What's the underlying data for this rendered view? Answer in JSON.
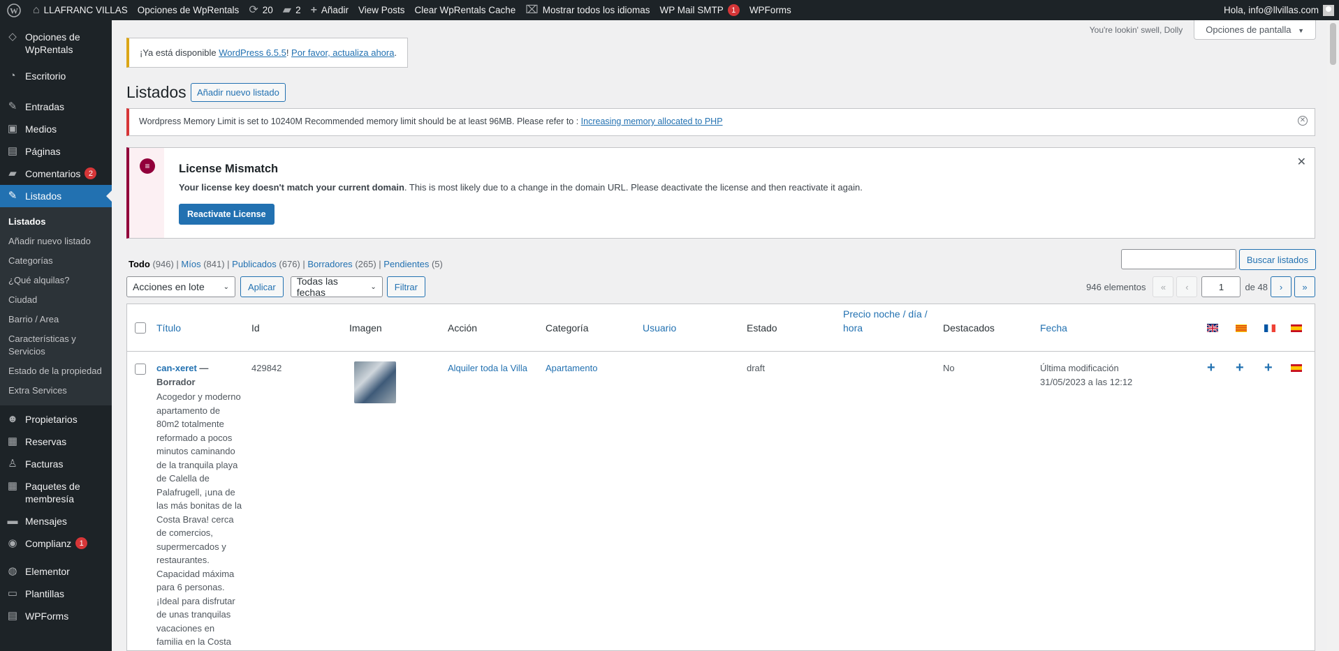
{
  "adminbar": {
    "site_name": "LLAFRANC VILLAS",
    "options": "Opciones de WpRentals",
    "updates_count": "20",
    "comments_count": "2",
    "add": "Añadir",
    "view_posts": "View Posts",
    "clear_cache": "Clear WpRentals Cache",
    "languages": "Mostrar todos los idiomas",
    "smtp": "WP Mail SMTP",
    "smtp_badge": "1",
    "wpforms": "WPForms",
    "greeting": "Hola, info@llvillas.com"
  },
  "sidebar": {
    "items": [
      {
        "label": "Opciones de WpRentals",
        "icon": "diamond-icon"
      },
      {
        "label": "Escritorio",
        "icon": "dashboard-icon"
      },
      {
        "label": "Entradas",
        "icon": "pin-icon"
      },
      {
        "label": "Medios",
        "icon": "media-icon"
      },
      {
        "label": "Páginas",
        "icon": "pages-icon"
      },
      {
        "label": "Comentarios",
        "icon": "comments-icon",
        "badge": "2"
      },
      {
        "label": "Listados",
        "icon": "pin-icon"
      }
    ],
    "submenu": [
      "Listados",
      "Añadir nuevo listado",
      "Categorías",
      "¿Qué alquilas?",
      "Ciudad",
      "Barrio / Area",
      "Características y Servicios",
      "Estado de la propiedad",
      "Extra Services"
    ],
    "items2": [
      {
        "label": "Propietarios",
        "icon": "users-icon"
      },
      {
        "label": "Reservas",
        "icon": "calendar-icon"
      },
      {
        "label": "Facturas",
        "icon": "invoice-icon"
      },
      {
        "label": "Paquetes de membresía",
        "icon": "package-icon"
      },
      {
        "label": "Mensajes",
        "icon": "messages-icon"
      },
      {
        "label": "Complianz",
        "icon": "complianz-icon",
        "badge": "1"
      },
      {
        "label": "Elementor",
        "icon": "elementor-icon"
      },
      {
        "label": "Plantillas",
        "icon": "folder-icon"
      },
      {
        "label": "WPForms",
        "icon": "wpforms-icon"
      }
    ]
  },
  "header": {
    "dolly": "You're lookin' swell, Dolly",
    "screen_options": "Opciones de pantalla"
  },
  "update_notice": {
    "prefix": "¡Ya está disponible ",
    "link1": "WordPress 6.5.5",
    "middle": "! ",
    "link2": "Por favor, actualiza ahora",
    "suffix": "."
  },
  "page": {
    "title": "Listados",
    "add_new": "Añadir nuevo listado"
  },
  "memory_notice": {
    "text": "Wordpress Memory Limit is set to 10240M Recommended memory limit should be at least 96MB. Please refer to : ",
    "link": "Increasing memory allocated to PHP"
  },
  "license": {
    "title": "License Mismatch",
    "bold": "Your license key doesn't match your current domain",
    "text": ". This is most likely due to a change in the domain URL. Please deactivate the license and then reactivate it again.",
    "button": "Reactivate License"
  },
  "filters": {
    "all": "Todo",
    "all_count": "(946)",
    "mine": "Míos",
    "mine_count": "(841)",
    "published": "Publicados",
    "published_count": "(676)",
    "drafts": "Borradores",
    "drafts_count": "(265)",
    "pending": "Pendientes",
    "pending_count": "(5)"
  },
  "search": {
    "button": "Buscar listados"
  },
  "tablenav": {
    "bulk": "Acciones en lote",
    "apply": "Aplicar",
    "dates": "Todas las fechas",
    "filter": "Filtrar",
    "count": "946 elementos",
    "page": "1",
    "of": "de 48"
  },
  "table": {
    "columns": [
      "Título",
      "Id",
      "Imagen",
      "Acción",
      "Categoría",
      "Usuario",
      "Estado",
      "Precio noche / día / hora",
      "Destacados",
      "Fecha"
    ],
    "row": {
      "title": "can-xeret",
      "status_suffix": " — Borrador",
      "description": "Acogedor y moderno apartamento de 80m2 totalmente reformado a pocos minutos caminando de la tranquila playa de Calella de Palafrugell, ¡una de las más bonitas de la Costa Brava! cerca de comercios, supermercados y restaurantes. Capacidad máxima para 6 personas. ¡Ideal para disfrutar de unas tranquilas vacaciones en familia en la Costa",
      "id": "429842",
      "action": "Alquiler toda la Villa",
      "category": "Apartamento",
      "state": "draft",
      "featured": "No",
      "date_label": "Última modificación",
      "date": "31/05/2023 a las 12:12"
    }
  }
}
